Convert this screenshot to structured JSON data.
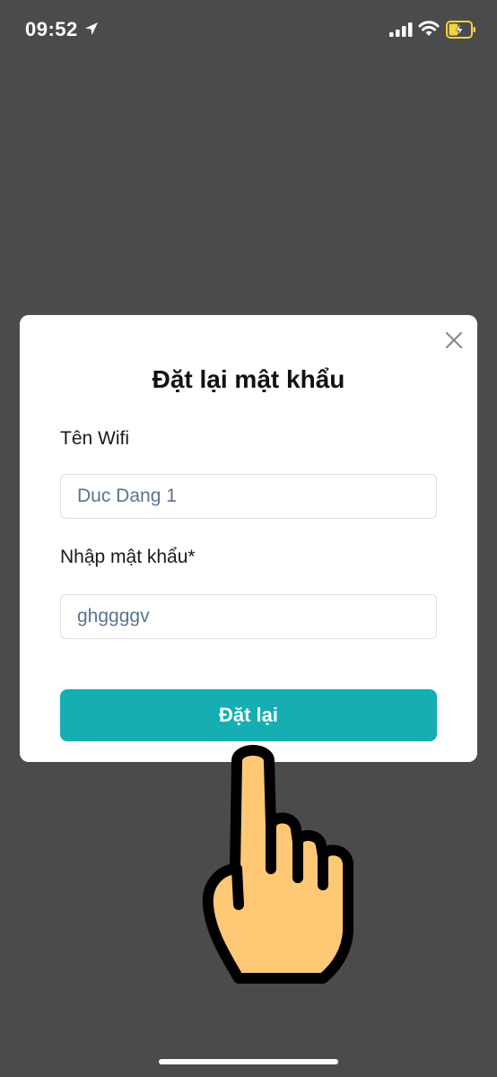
{
  "status_bar": {
    "time": "09:52",
    "icons": [
      "location-arrow-icon",
      "cellular-signal-icon",
      "wifi-icon",
      "battery-charging-icon"
    ]
  },
  "modal": {
    "title": "Đặt lại mật khẩu",
    "close_icon": "close-icon",
    "wifi_label": "Tên Wifi",
    "wifi_value": "Duc Dang 1",
    "password_label": "Nhập mật khẩu*",
    "password_value": "ghggggv",
    "submit_label": "Đặt lại"
  },
  "colors": {
    "background": "#4b4b4b",
    "button": "#14aeb3",
    "input_text": "#5a7390",
    "hand_fill": "#ffc875",
    "battery": "#f5d33a"
  },
  "overlay": {
    "icon": "pointing-hand-icon"
  }
}
